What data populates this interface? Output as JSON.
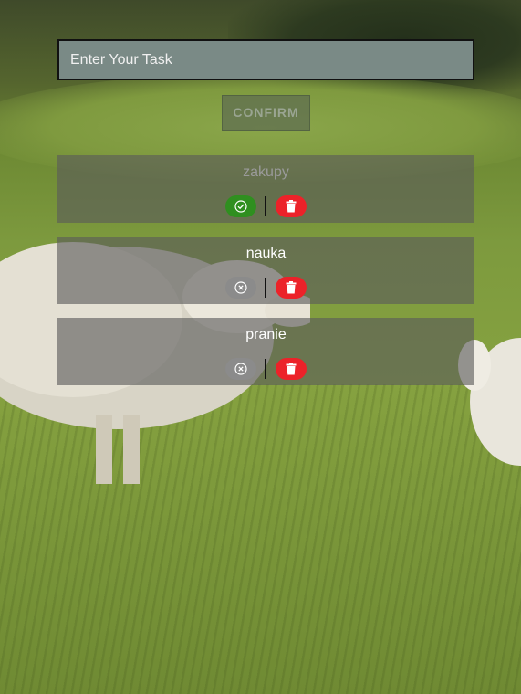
{
  "input": {
    "placeholder": "Enter Your Task",
    "value": ""
  },
  "confirm": {
    "label": "CONFIRM"
  },
  "tasks": [
    {
      "title": "zakupy",
      "completed": true,
      "toggle_icon": "check-circle-icon",
      "delete_icon": "trash-icon"
    },
    {
      "title": "nauka",
      "completed": false,
      "toggle_icon": "x-circle-icon",
      "delete_icon": "trash-icon"
    },
    {
      "title": "pranie",
      "completed": false,
      "toggle_icon": "x-circle-icon",
      "delete_icon": "trash-icon"
    }
  ],
  "colors": {
    "complete_toggle": "#2f8f1f",
    "incomplete_toggle": "#8b8b8b",
    "delete": "#ec2229",
    "card": "rgba(90,90,90,0.62)",
    "input_bg": "#7a8a86"
  },
  "background": {
    "description_icon": "sheep-pasture-photo"
  }
}
